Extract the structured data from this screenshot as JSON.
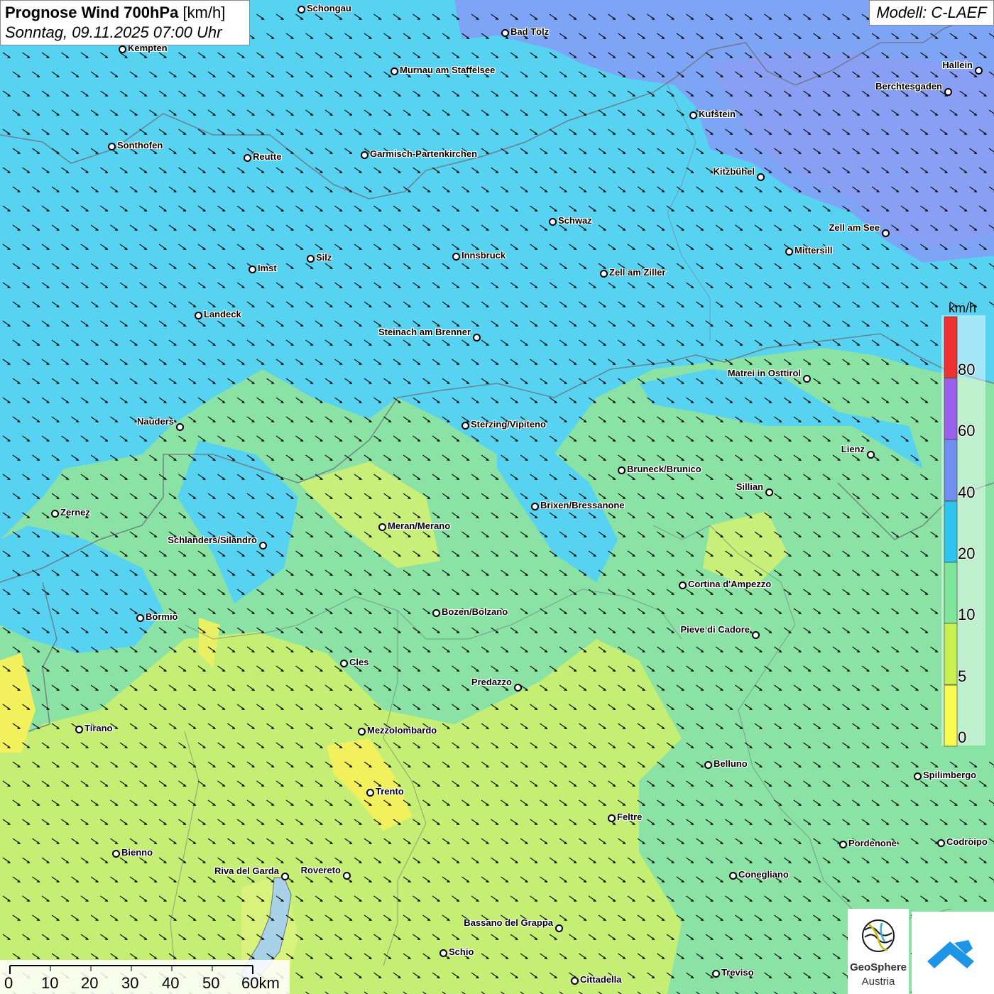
{
  "title": {
    "bold": "Prognose Wind 700hPa",
    "unit": "[km/h]",
    "datetime": "Sonntag, 09.11.2025 07:00 Uhr"
  },
  "model": "Modell: C-LAEF",
  "legend": {
    "unit": "km/h",
    "labels": [
      "80",
      "60",
      "40",
      "20",
      "10",
      "5",
      "0"
    ],
    "colors": [
      "#f03030",
      "#9a60ec",
      "#6f8ef0",
      "#2ec4f0",
      "#7de69a",
      "#c8f050",
      "#fafa50"
    ]
  },
  "wind_direction": "NW",
  "places": [
    {
      "name": "Schongau",
      "side": "r"
    },
    {
      "name": "Bad Tölz",
      "side": "r"
    },
    {
      "name": "Kempten",
      "side": "r"
    },
    {
      "name": "Murnau am Staffelsee",
      "side": "r"
    },
    {
      "name": "Hallein",
      "side": "l"
    },
    {
      "name": "Berchtesgaden",
      "side": "l"
    },
    {
      "name": "Kufstein",
      "side": "r"
    },
    {
      "name": "Sonthofen",
      "side": "r"
    },
    {
      "name": "Reutte",
      "side": "r"
    },
    {
      "name": "Garmisch-Partenkirchen",
      "side": "r"
    },
    {
      "name": "Kitzbühel",
      "side": "l"
    },
    {
      "name": "Schwaz",
      "side": "r"
    },
    {
      "name": "Zell am See",
      "side": "l"
    },
    {
      "name": "Mittersill",
      "side": "r"
    },
    {
      "name": "Innsbruck",
      "side": "r"
    },
    {
      "name": "Silz",
      "side": "r"
    },
    {
      "name": "Imst",
      "side": "r"
    },
    {
      "name": "Zell am Ziller",
      "side": "r"
    },
    {
      "name": "Landeck",
      "side": "r"
    },
    {
      "name": "Steinach am Brenner",
      "side": "l"
    },
    {
      "name": "Matrei in Osttirol",
      "side": "l"
    },
    {
      "name": "Nauders",
      "side": "l"
    },
    {
      "name": "Sterzing/Vipiteno",
      "side": "r"
    },
    {
      "name": "Lienz",
      "side": "l"
    },
    {
      "name": "Bruneck/Brunico",
      "side": "r"
    },
    {
      "name": "Sillian",
      "side": "l"
    },
    {
      "name": "Zernez",
      "side": "r"
    },
    {
      "name": "Brixen/Bressanone",
      "side": "r"
    },
    {
      "name": "Meran/Merano",
      "side": "r"
    },
    {
      "name": "Schlanders/Silandro",
      "side": "l"
    },
    {
      "name": "Cortina d'Ampezzo",
      "side": "r"
    },
    {
      "name": "Bozen/Bolzano",
      "side": "r"
    },
    {
      "name": "Bormio",
      "side": "r"
    },
    {
      "name": "Pieve di Cadore",
      "side": "l"
    },
    {
      "name": "Cles",
      "side": "r"
    },
    {
      "name": "Predazzo",
      "side": "l"
    },
    {
      "name": "Tirano",
      "side": "r"
    },
    {
      "name": "Mezzolombardo",
      "side": "r"
    },
    {
      "name": "Belluno",
      "side": "r"
    },
    {
      "name": "Spilimbergo",
      "side": "r"
    },
    {
      "name": "Trento",
      "side": "r"
    },
    {
      "name": "Feltre",
      "side": "r"
    },
    {
      "name": "Pordenone",
      "side": "r"
    },
    {
      "name": "Codroipo",
      "side": "r"
    },
    {
      "name": "Bienno",
      "side": "r"
    },
    {
      "name": "Riva del Garda",
      "side": "l"
    },
    {
      "name": "Rovereto",
      "side": "l"
    },
    {
      "name": "Conegliano",
      "side": "r"
    },
    {
      "name": "Bassano del Grappa",
      "side": "l"
    },
    {
      "name": "Schio",
      "side": "r"
    },
    {
      "name": "Treviso",
      "side": "r"
    },
    {
      "name": "Cittadella",
      "side": "r"
    }
  ],
  "scale_bar": {
    "labels": [
      "0",
      "10",
      "20",
      "30",
      "40",
      "50",
      "60km"
    ]
  },
  "logos": {
    "geosphere_line1": "GeoSphere",
    "geosphere_line2": "Austria"
  }
}
